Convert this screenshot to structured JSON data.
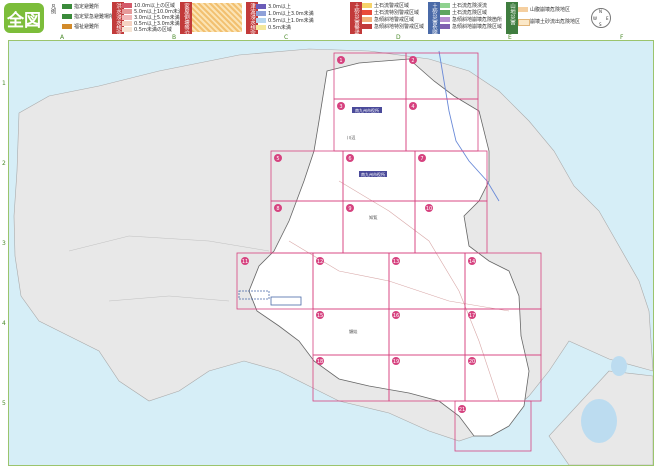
{
  "title": "全図",
  "legend": {
    "shelters_heading": "凡例",
    "shelter_items": [
      "指定避難所",
      "指定緊急避難場所",
      "福祉避難所"
    ],
    "flood_heading": "洪水浸水想定区域",
    "flood_levels": [
      "10.0m以上の区域",
      "5.0m以上10.0m未満の区域",
      "3.0m以上5.0m未満の区域",
      "0.5m以上3.0m未満の区域",
      "0.5m未満の区域"
    ],
    "hazard_heading": "家屋倒壊等氾濫想定区域",
    "tsunami_heading": "津波浸水想定",
    "tsunami_levels": [
      "3.0m以上",
      "1.0m以上3.0m未満",
      "0.5m以上1.0m未満",
      "0.5m未満"
    ],
    "landslide_heading": "土砂災害警戒区域",
    "landslide_items": [
      "土石流警戒区域",
      "土石流特別警戒区域",
      "急傾斜地警戒区域",
      "急傾斜地特別警戒区域"
    ],
    "landslide2_heading": "土砂災害危険箇所",
    "landslide2_items": [
      "土石流危険渓流",
      "土石流危険区域",
      "急傾斜地崩壊危険箇所",
      "急傾斜地崩壊危険区域"
    ],
    "mountain_heading": "山地災害",
    "mountain_items": [
      "山腹崩壊危険地区",
      "崩壊土砂流出危険地区"
    ],
    "colors": {
      "red": "#c23a3a",
      "blue": "#4a6aa8",
      "green": "#3f7d3f",
      "pink": "#d6427f"
    }
  },
  "compass": {
    "n": "N",
    "s": "S",
    "e": "E",
    "w": "W"
  },
  "grid": {
    "columns": [
      "A",
      "B",
      "C",
      "D",
      "E",
      "F"
    ],
    "rows": [
      "1",
      "2",
      "3",
      "4",
      "5"
    ]
  },
  "tiles": [
    "1",
    "2",
    "3",
    "4",
    "5",
    "6",
    "7",
    "8",
    "9",
    "10",
    "11",
    "12",
    "13",
    "14",
    "15",
    "16",
    "17",
    "18",
    "19",
    "20",
    "21"
  ],
  "places": [
    "南九州市役所",
    "南九州市役所",
    "知覧",
    "頴娃",
    "川辺"
  ]
}
